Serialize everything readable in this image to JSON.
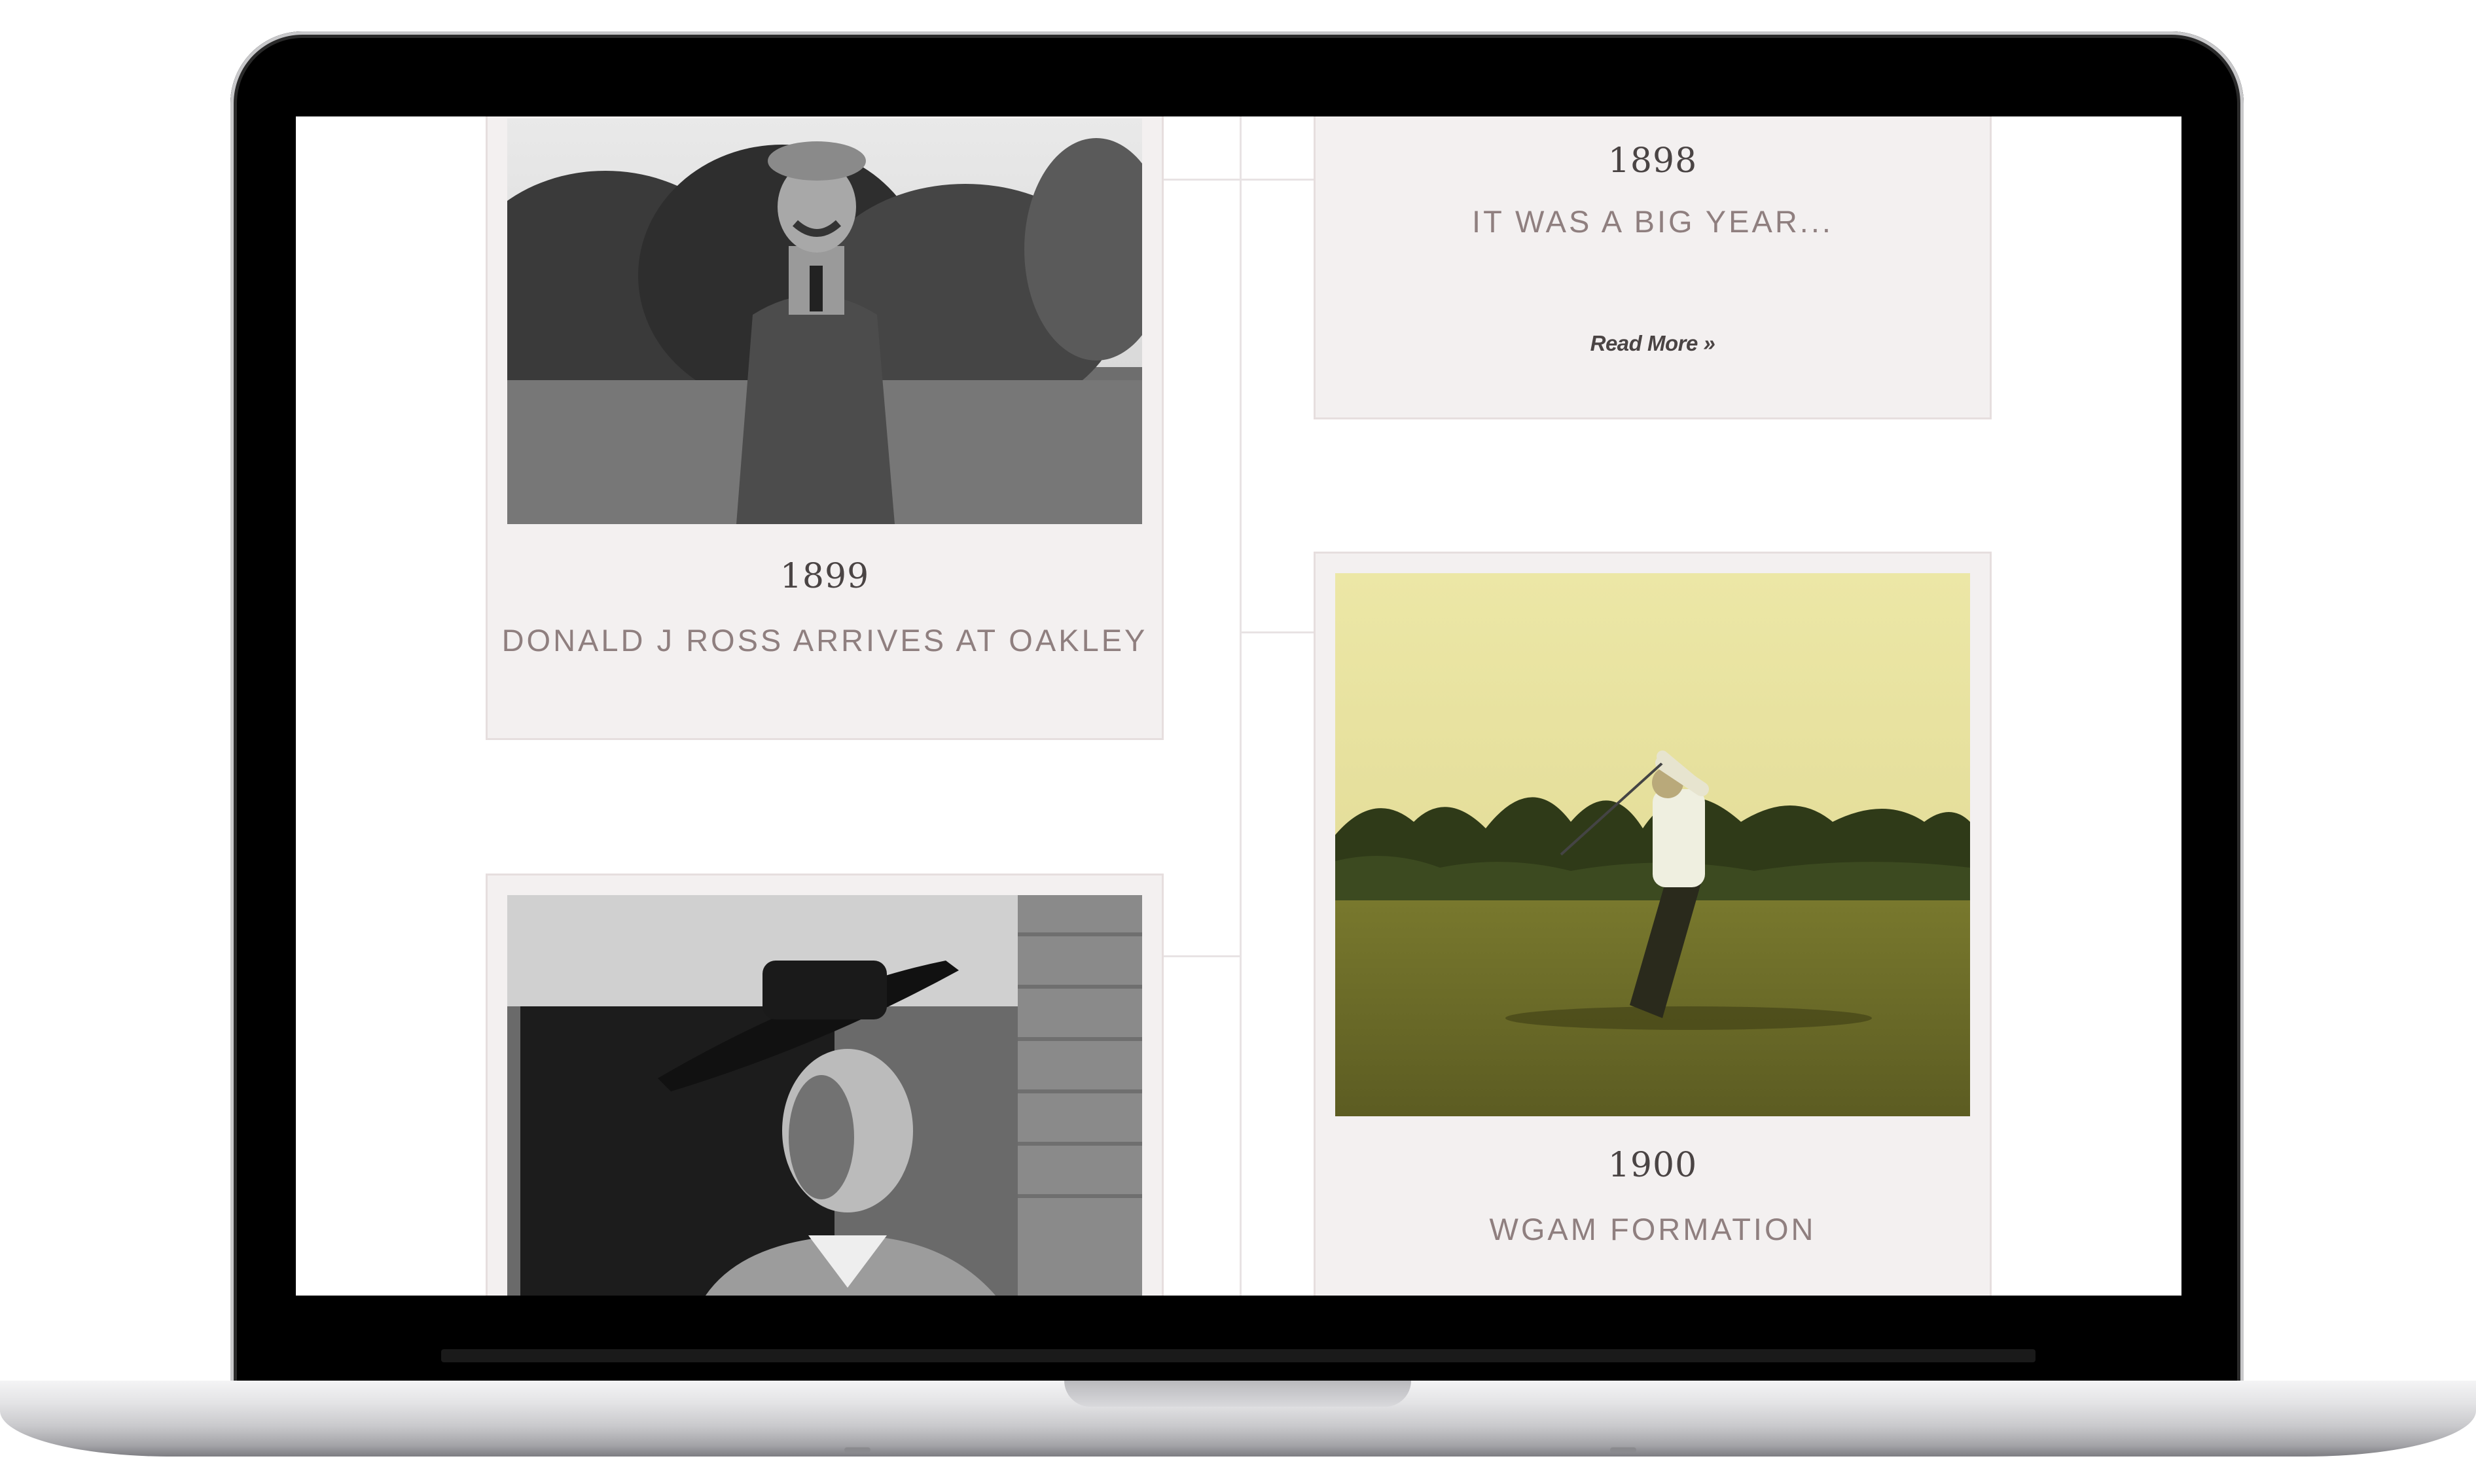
{
  "timeline": {
    "entries": [
      {
        "year": "1898",
        "title": "IT WAS A BIG YEAR...",
        "link_label": "Read More »"
      },
      {
        "year": "1899",
        "title": "DONALD J ROSS ARRIVES AT OAKLEY"
      },
      {
        "year": "1900",
        "title": "WGAM FORMATION"
      },
      {
        "year": "",
        "title": ""
      }
    ]
  },
  "colors": {
    "card_background": "#f3f0f0",
    "card_border": "#e6dede",
    "title_text": "#8f7f7f",
    "year_text": "#4a4444",
    "timeline_line": "#e8e3e4"
  },
  "icons": {
    "photo_1899": "photo-portrait-man-icon",
    "photo_1900": "photo-golfer-swing-icon",
    "photo_woman": "photo-portrait-woman-icon"
  }
}
